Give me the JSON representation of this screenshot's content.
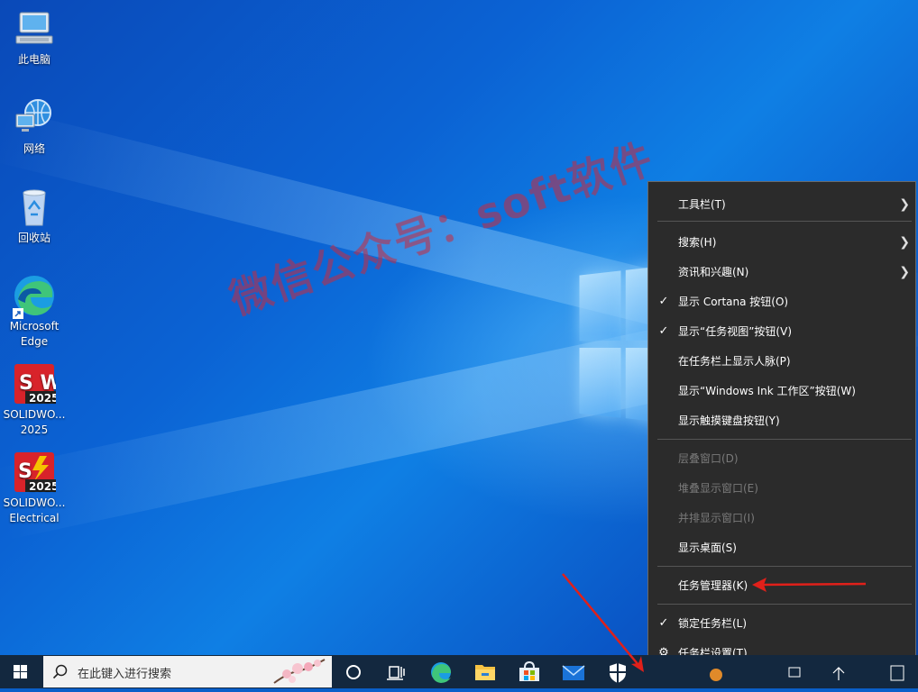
{
  "desktop_icons": [
    {
      "label": "此电脑",
      "icon": "computer-icon"
    },
    {
      "label": "网络",
      "icon": "network-icon"
    },
    {
      "label": "回收站",
      "icon": "recycle-bin-icon"
    },
    {
      "label": "Microsoft\nEdge",
      "icon": "edge-icon"
    },
    {
      "label": "SOLIDWO...\n2025",
      "icon": "solidworks-icon",
      "badge": "2025",
      "letters": "S W"
    },
    {
      "label": "SOLIDWO...\nElectrical",
      "icon": "solidworks-electrical-icon",
      "badge": "2025",
      "letters": "S"
    }
  ],
  "watermark": "微信公众号：soft软件",
  "context_menu": {
    "items": [
      {
        "label": "工具栏(T)",
        "submenu": true
      },
      {
        "label": "搜索(H)",
        "submenu": true
      },
      {
        "label": "资讯和兴趣(N)",
        "submenu": true
      },
      {
        "label": "显示 Cortana 按钮(O)",
        "checked": true
      },
      {
        "label": "显示“任务视图”按钮(V)",
        "checked": true
      },
      {
        "label": "在任务栏上显示人脉(P)"
      },
      {
        "label": "显示“Windows Ink 工作区”按钮(W)"
      },
      {
        "label": "显示触摸键盘按钮(Y)"
      },
      {
        "label": "层叠窗口(D)",
        "disabled": true
      },
      {
        "label": "堆叠显示窗口(E)",
        "disabled": true
      },
      {
        "label": "并排显示窗口(I)",
        "disabled": true
      },
      {
        "label": "显示桌面(S)"
      },
      {
        "label": "任务管理器(K)"
      },
      {
        "label": "锁定任务栏(L)",
        "checked": true
      },
      {
        "label": "任务栏设置(T)",
        "icon": "gear-icon"
      }
    ]
  },
  "taskbar": {
    "search_placeholder": "在此键入进行搜索",
    "apps": [
      "cortana-icon",
      "task-view-icon",
      "edge-icon",
      "file-explorer-icon",
      "store-icon",
      "mail-icon",
      "security-icon"
    ]
  },
  "colors": {
    "menu_bg": "#2b2b2b",
    "taskbar_bg": "#13283f",
    "annotation_red": "#e0201a",
    "watermark": "#c8283c"
  }
}
